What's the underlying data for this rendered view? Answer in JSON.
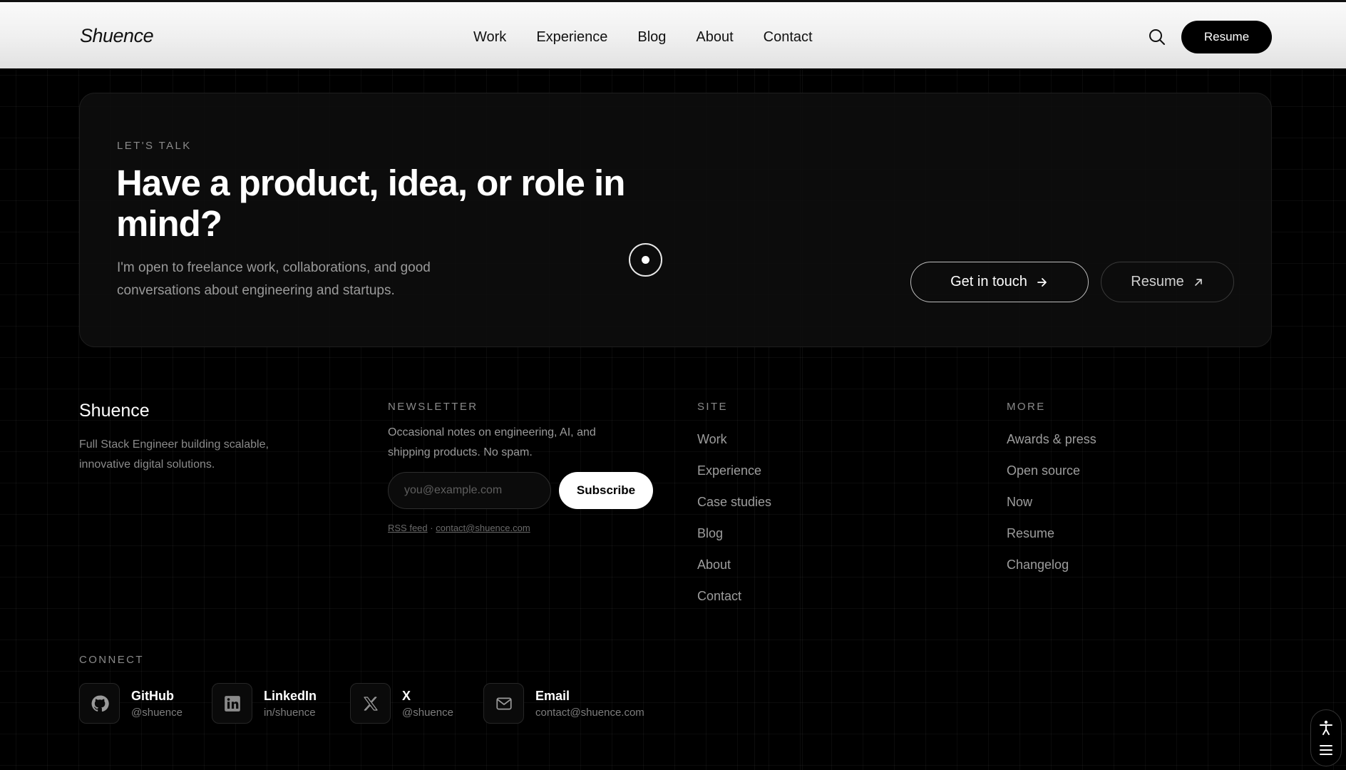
{
  "header": {
    "brand": "Shuence",
    "nav": [
      "Work",
      "Experience",
      "Blog",
      "About",
      "Contact"
    ],
    "resume_label": "Resume"
  },
  "cta": {
    "eyebrow": "LET'S TALK",
    "title": "Have a product, idea, or role in mind?",
    "description": "I'm open to freelance work, collaborations, and good conversations about engineering and startups.",
    "primary_label": "Get in touch",
    "secondary_label": "Resume"
  },
  "footer": {
    "brand": "Shuence",
    "tagline": "Full Stack Engineer building scalable, innovative digital solutions.",
    "newsletter": {
      "heading": "NEWSLETTER",
      "description": "Occasional notes on engineering, AI, and shipping products. No spam.",
      "placeholder": "you@example.com",
      "subscribe_label": "Subscribe",
      "rss_label": "RSS feed",
      "separator": "·",
      "email_link": "contact@shuence.com"
    },
    "site": {
      "heading": "SITE",
      "items": [
        "Work",
        "Experience",
        "Case studies",
        "Blog",
        "About",
        "Contact"
      ]
    },
    "more": {
      "heading": "MORE",
      "items": [
        "Awards & press",
        "Open source",
        "Now",
        "Resume",
        "Changelog"
      ]
    },
    "connect": {
      "heading": "CONNECT",
      "items": [
        {
          "name": "GitHub",
          "handle": "@shuence",
          "icon": "github-icon"
        },
        {
          "name": "LinkedIn",
          "handle": "in/shuence",
          "icon": "linkedin-icon"
        },
        {
          "name": "X",
          "handle": "@shuence",
          "icon": "x-icon"
        },
        {
          "name": "Email",
          "handle": "contact@shuence.com",
          "icon": "mail-icon"
        }
      ]
    }
  }
}
